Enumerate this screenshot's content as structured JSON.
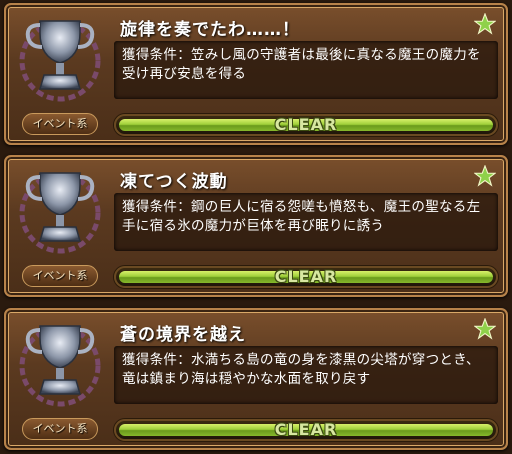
{
  "achievements": [
    {
      "title": "旋律を奏でたわ……！",
      "condition": "獲得条件：笠みし風の守護者は最後に真なる魔王の魔力を受け再び安息を得る",
      "category": "イベント系",
      "status": "CLEAR",
      "progress_percent": 100
    },
    {
      "title": "凍てつく波動",
      "condition": "獲得条件：鋼の巨人に宿る怨嗟も憤怒も、魔王の聖なる左手に宿る氷の魔力が巨体を再び眠りに誘う",
      "category": "イベント系",
      "status": "CLEAR",
      "progress_percent": 100
    },
    {
      "title": "蒼の境界を越え",
      "condition": "獲得条件：水満ちる島の竜の身を漆黒の尖塔が穿つとき、竜は鎮まり海は穏やかな水面を取り戻す",
      "category": "イベント系",
      "status": "CLEAR",
      "progress_percent": 100
    }
  ],
  "colors": {
    "panel": "#5b3a20",
    "panel_border": "#b8834a",
    "bar_fill": "#9fd03a",
    "star": "#8fd14a"
  },
  "icons": {
    "trophy": "trophy-icon",
    "star": "star-icon"
  }
}
